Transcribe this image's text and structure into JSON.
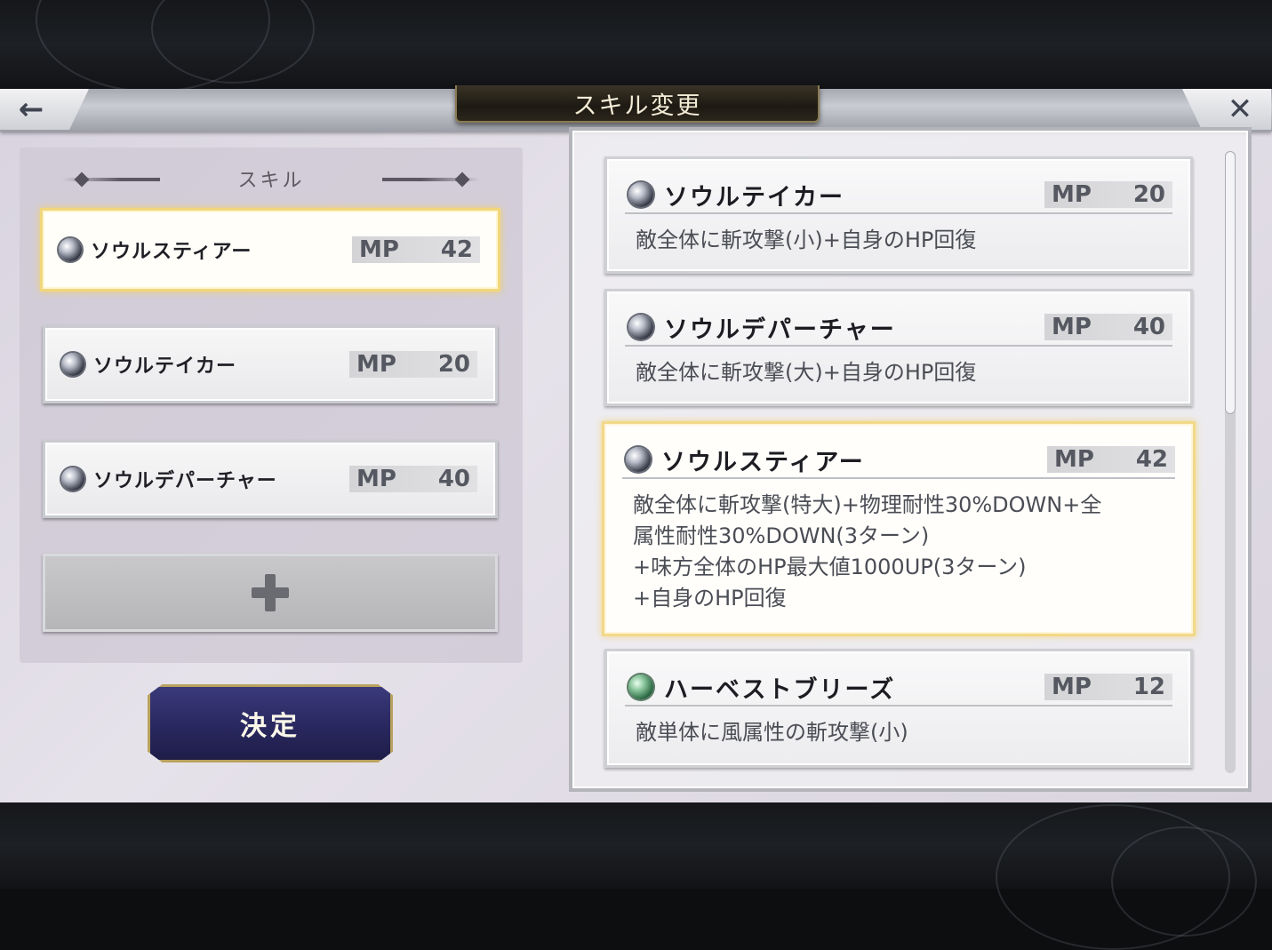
{
  "header": {
    "title": "スキル変更",
    "back_icon": "←",
    "close_icon": "✕"
  },
  "left": {
    "heading": "スキル",
    "equipped": [
      {
        "name": "ソウルスティアー",
        "mp_label": "MP",
        "mp": "42",
        "selected": true
      },
      {
        "name": "ソウルテイカー",
        "mp_label": "MP",
        "mp": "20",
        "selected": false
      },
      {
        "name": "ソウルデパーチャー",
        "mp_label": "MP",
        "mp": "40",
        "selected": false
      }
    ],
    "add_icon": "plus",
    "confirm_label": "決定"
  },
  "skills": [
    {
      "name": "ソウルテイカー",
      "mp_label": "MP",
      "mp": "20",
      "desc": "敵全体に斬攻撃(小)+自身のHP回復",
      "orb": "dark"
    },
    {
      "name": "ソウルデパーチャー",
      "mp_label": "MP",
      "mp": "40",
      "desc": "敵全体に斬攻撃(大)+自身のHP回復",
      "orb": "dark"
    },
    {
      "name": "ソウルスティアー",
      "mp_label": "MP",
      "mp": "42",
      "desc": "敵全体に斬攻撃(特大)+物理耐性30%DOWN+全\n属性耐性30%DOWN(3ターン)\n+味方全体のHP最大値1000UP(3ターン)\n+自身のHP回復",
      "orb": "dark",
      "selected": true
    },
    {
      "name": "ハーベストブリーズ",
      "mp_label": "MP",
      "mp": "12",
      "desc": "敵単体に風属性の斬攻撃(小)",
      "orb": "wind"
    }
  ]
}
